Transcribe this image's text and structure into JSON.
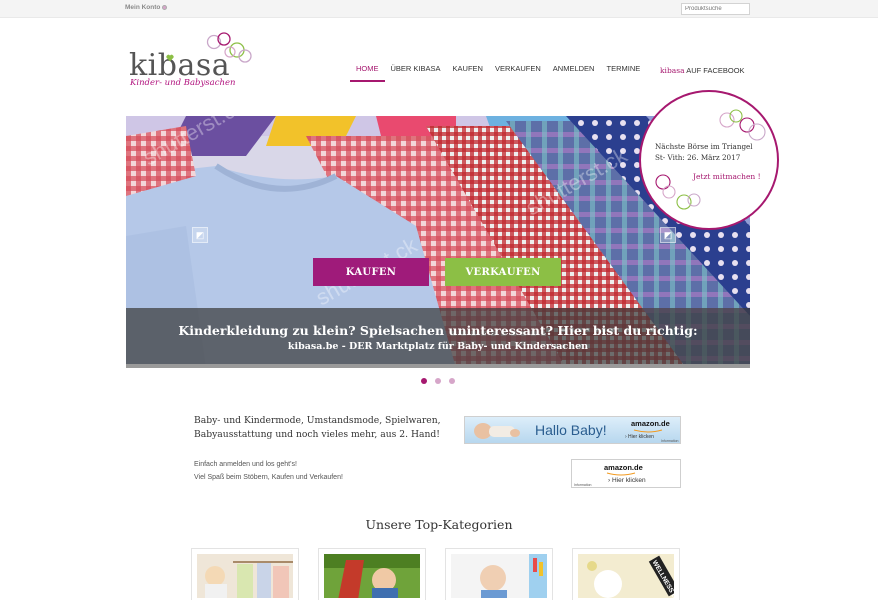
{
  "topbar": {
    "account_label": "Mein Konto",
    "search_placeholder": "Produktsuche"
  },
  "logo": {
    "word": "kibasa",
    "tagline": "Kinder- und Babysachen"
  },
  "nav": {
    "items": [
      {
        "label": "HOME",
        "active": true
      },
      {
        "label": "ÜBER KIBASA"
      },
      {
        "label": "KAUFEN"
      },
      {
        "label": "VERKAUFEN"
      },
      {
        "label": "ANMELDEN"
      },
      {
        "label": "TERMINE"
      }
    ],
    "facebook_brand": "kibasa",
    "facebook_label": "AUF FACEBOOK"
  },
  "colors": {
    "brand": "#a6186f",
    "green": "#8cbf45",
    "kaufen_button": "#9f1b7a"
  },
  "slider": {
    "kaufen_label": "KAUFEN",
    "verkaufen_label": "VERKAUFEN",
    "headline": "Kinderkleidung zu klein? Spielsachen uninteressant? Hier bist du richtig:",
    "subline": "kibasa.be -  DER Marktplatz für Baby- und Kindersachen",
    "dots": 3,
    "active_dot": 1
  },
  "badge": {
    "line1": "Nächste Börse im Triangel",
    "line2": "St- Vith: 26. März 2017",
    "cta": "Jetzt mitmachen !"
  },
  "content": {
    "intro_line1": "Baby- und Kindermode, Umstandsmode, Spielwaren,",
    "intro_line2": "Babyausstattung und noch vieles mehr, aus 2. Hand!",
    "note_line1": "Einfach anmelden und los geht's!",
    "note_line2": "Viel Spaß beim Stöbern, Kaufen und Verkaufen!"
  },
  "ads": {
    "banner_text": "Hallo Baby!",
    "amazon_logo": "amazon.de",
    "amazon_link": "› Hier klicken",
    "amazon_info": "Information",
    "small_link": "› Hier klicken"
  },
  "categories": {
    "title": "Unsere Top-Kategorien",
    "items": [
      {
        "icon": "clothes-photo"
      },
      {
        "icon": "stroller-photo"
      },
      {
        "icon": "toddler-photo"
      },
      {
        "icon": "wellness-photo",
        "tag": "WELLNESS LINIE"
      }
    ]
  }
}
